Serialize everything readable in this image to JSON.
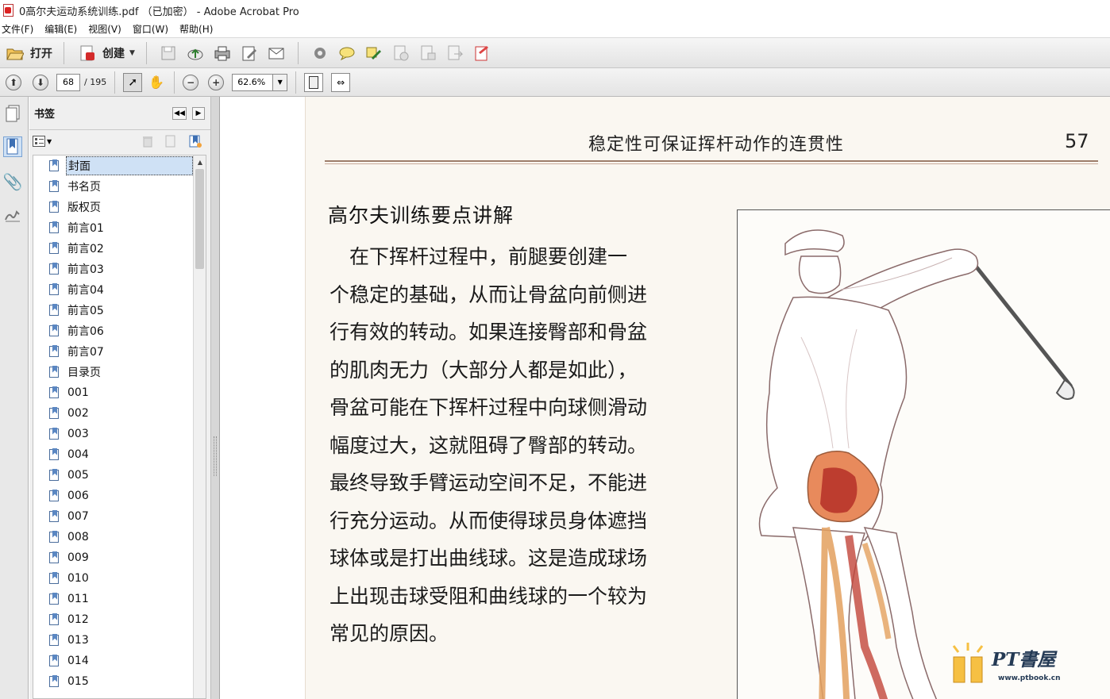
{
  "window": {
    "title": "0高尔夫运动系统训练.pdf （已加密） - Adobe Acrobat Pro"
  },
  "menu": [
    "文件(F)",
    "编辑(E)",
    "视图(V)",
    "窗口(W)",
    "帮助(H)"
  ],
  "toolbar": {
    "open_label": "打开",
    "create_label": "创建"
  },
  "nav": {
    "current_page": "68",
    "total_pages": "/ 195",
    "zoom": "62.6%"
  },
  "bookmarks": {
    "title": "书签",
    "items": [
      "封面",
      "书名页",
      "版权页",
      "前言01",
      "前言02",
      "前言03",
      "前言04",
      "前言05",
      "前言06",
      "前言07",
      "目录页",
      "001",
      "002",
      "003",
      "004",
      "005",
      "006",
      "007",
      "008",
      "009",
      "010",
      "011",
      "012",
      "013",
      "014",
      "015"
    ]
  },
  "document": {
    "running_header": "稳定性可保证挥杆动作的连贯性",
    "page_number": "57",
    "section_title": "高尔夫训练要点讲解",
    "body_lines": [
      "　在下挥杆过程中，前腿要创建一",
      "个稳定的基础，从而让骨盆向前侧进",
      "行有效的转动。如果连接臀部和骨盆",
      "的肌肉无力（大部分人都是如此），",
      "骨盆可能在下挥杆过程中向球侧滑动",
      "幅度过大，这就阻碍了臀部的转动。",
      "最终导致手臂运动空间不足，不能进",
      "行充分运动。从而使得球员身体遮挡",
      "球体或是打出曲线球。这是造成球场",
      "上出现击球受阻和曲线球的一个较为",
      "常见的原因。"
    ],
    "watermark_text": "PT書屋",
    "watermark_url": "www.ptbook.cn"
  }
}
